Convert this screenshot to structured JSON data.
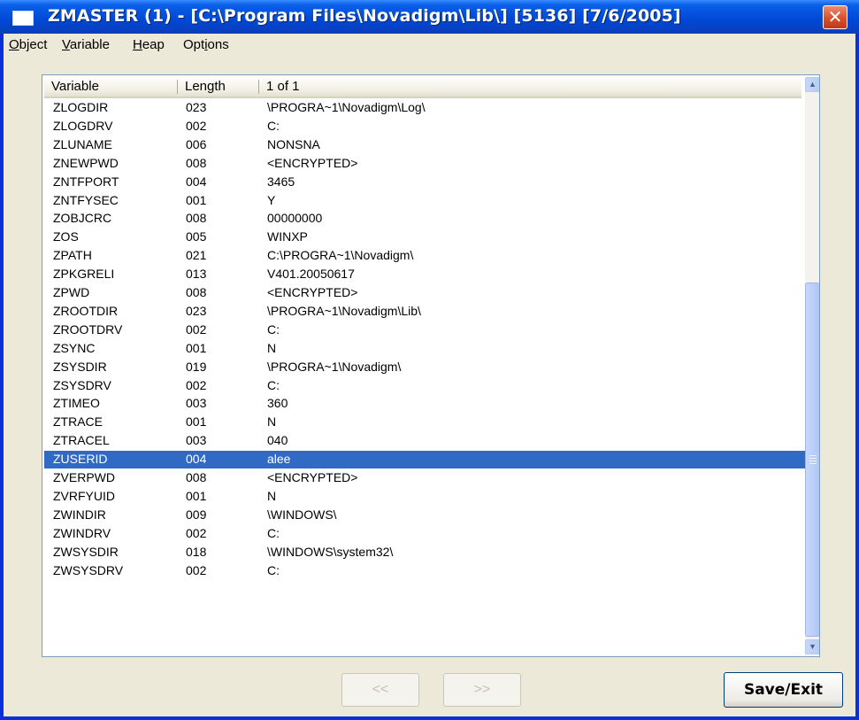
{
  "window": {
    "title": "ZMASTER (1) - [C:\\Program Files\\Novadigm\\Lib\\]  [5136]  [7/6/2005]",
    "close_label": "✕"
  },
  "menu": [
    {
      "acc": "O",
      "rest": "bject"
    },
    {
      "acc": "V",
      "rest": "ariable"
    },
    {
      "acc": "H",
      "rest": "eap"
    },
    {
      "pre": "Opt",
      "acc": "i",
      "rest": "ons"
    }
  ],
  "table": {
    "columns": [
      "Variable",
      "Length",
      "1 of 1"
    ],
    "rows": [
      [
        "ZLOGDIR",
        "023",
        "\\PROGRA~1\\Novadigm\\Log\\"
      ],
      [
        "ZLOGDRV",
        "002",
        "C:"
      ],
      [
        "ZLUNAME",
        "006",
        "NONSNA"
      ],
      [
        "ZNEWPWD",
        "008",
        "<ENCRYPTED>"
      ],
      [
        "ZNTFPORT",
        "004",
        "3465"
      ],
      [
        "ZNTFYSEC",
        "001",
        "Y"
      ],
      [
        "ZOBJCRC",
        "008",
        "00000000"
      ],
      [
        "ZOS",
        "005",
        "WINXP"
      ],
      [
        "ZPATH",
        "021",
        "C:\\PROGRA~1\\Novadigm\\"
      ],
      [
        "ZPKGRELI",
        "013",
        "V401.20050617"
      ],
      [
        "ZPWD",
        "008",
        "<ENCRYPTED>"
      ],
      [
        "ZROOTDIR",
        "023",
        "\\PROGRA~1\\Novadigm\\Lib\\"
      ],
      [
        "ZROOTDRV",
        "002",
        "C:"
      ],
      [
        "ZSYNC",
        "001",
        "N"
      ],
      [
        "ZSYSDIR",
        "019",
        "\\PROGRA~1\\Novadigm\\"
      ],
      [
        "ZSYSDRV",
        "002",
        "C:"
      ],
      [
        "ZTIMEO",
        "003",
        "360"
      ],
      [
        "ZTRACE",
        "001",
        "N"
      ],
      [
        "ZTRACEL",
        "003",
        "040"
      ],
      [
        "ZUSERID",
        "004",
        "alee"
      ],
      [
        "ZVERPWD",
        "008",
        "<ENCRYPTED>"
      ],
      [
        "ZVRFYUID",
        "001",
        "N"
      ],
      [
        "ZWINDIR",
        "009",
        "\\WINDOWS\\"
      ],
      [
        "ZWINDRV",
        "002",
        "C:"
      ],
      [
        "ZWSYSDIR",
        "018",
        "\\WINDOWS\\system32\\"
      ],
      [
        "ZWSYSDRV",
        "002",
        "C:"
      ]
    ],
    "selected_row": 19
  },
  "buttons": {
    "prev": "<<",
    "next": ">>",
    "save_exit": "Save/Exit"
  },
  "colors": {
    "title_bar": "#0A5FE8",
    "selection": "#316AC5",
    "window_face": "#ECE9D8"
  }
}
